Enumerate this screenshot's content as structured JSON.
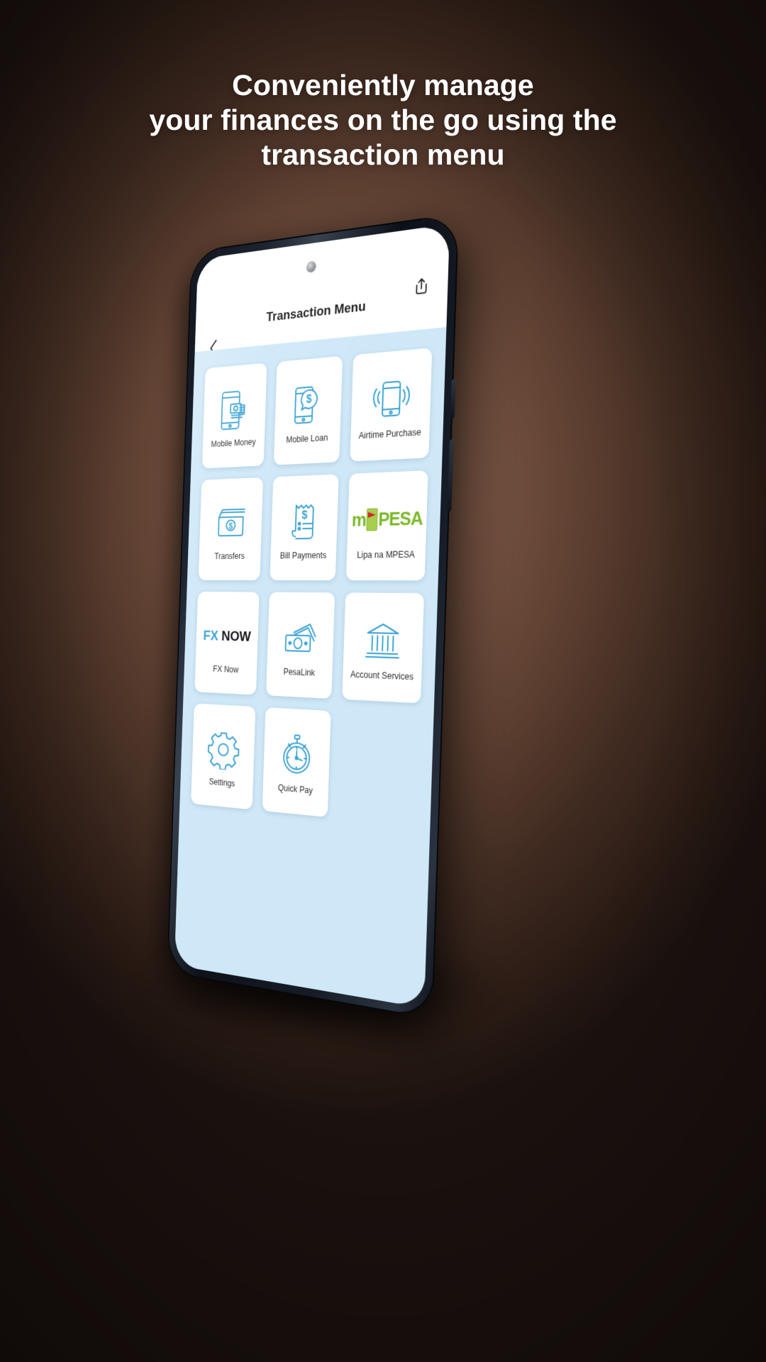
{
  "headline": {
    "line1": "Conveniently manage",
    "line2": "your finances on the go using the",
    "line3": "transaction menu"
  },
  "colors": {
    "background_dark": "#2a1b14",
    "background_warm": "#8a6350",
    "screen_blue": "#cfe8f8",
    "icon_blue": "#3ba3d4",
    "bezel": "#11161f",
    "mpesa_green": "#7ab929",
    "mpesa_red": "#d5222c"
  },
  "app": {
    "title": "Transaction Menu",
    "back_icon": "chevron-left-icon",
    "share_icon": "share-icon",
    "tiles": [
      {
        "label": "Mobile Money",
        "icon": "mobile-money-icon"
      },
      {
        "label": "Mobile Loan",
        "icon": "mobile-loan-icon"
      },
      {
        "label": "Airtime Purchase",
        "icon": "airtime-purchase-icon"
      },
      {
        "label": "Transfers",
        "icon": "wallet-transfers-icon"
      },
      {
        "label": "Bill Payments",
        "icon": "receipt-bill-icon"
      },
      {
        "label": "Lipa na MPESA",
        "icon": "mpesa-logo-icon"
      },
      {
        "label": "FX Now",
        "icon": "fx-now-wordmark-icon"
      },
      {
        "label": "PesaLink",
        "icon": "banknotes-icon"
      },
      {
        "label": "Account Services",
        "icon": "bank-building-icon"
      },
      {
        "label": "Settings",
        "icon": "gear-icon"
      },
      {
        "label": "Quick Pay",
        "icon": "stopwatch-icon"
      }
    ]
  }
}
